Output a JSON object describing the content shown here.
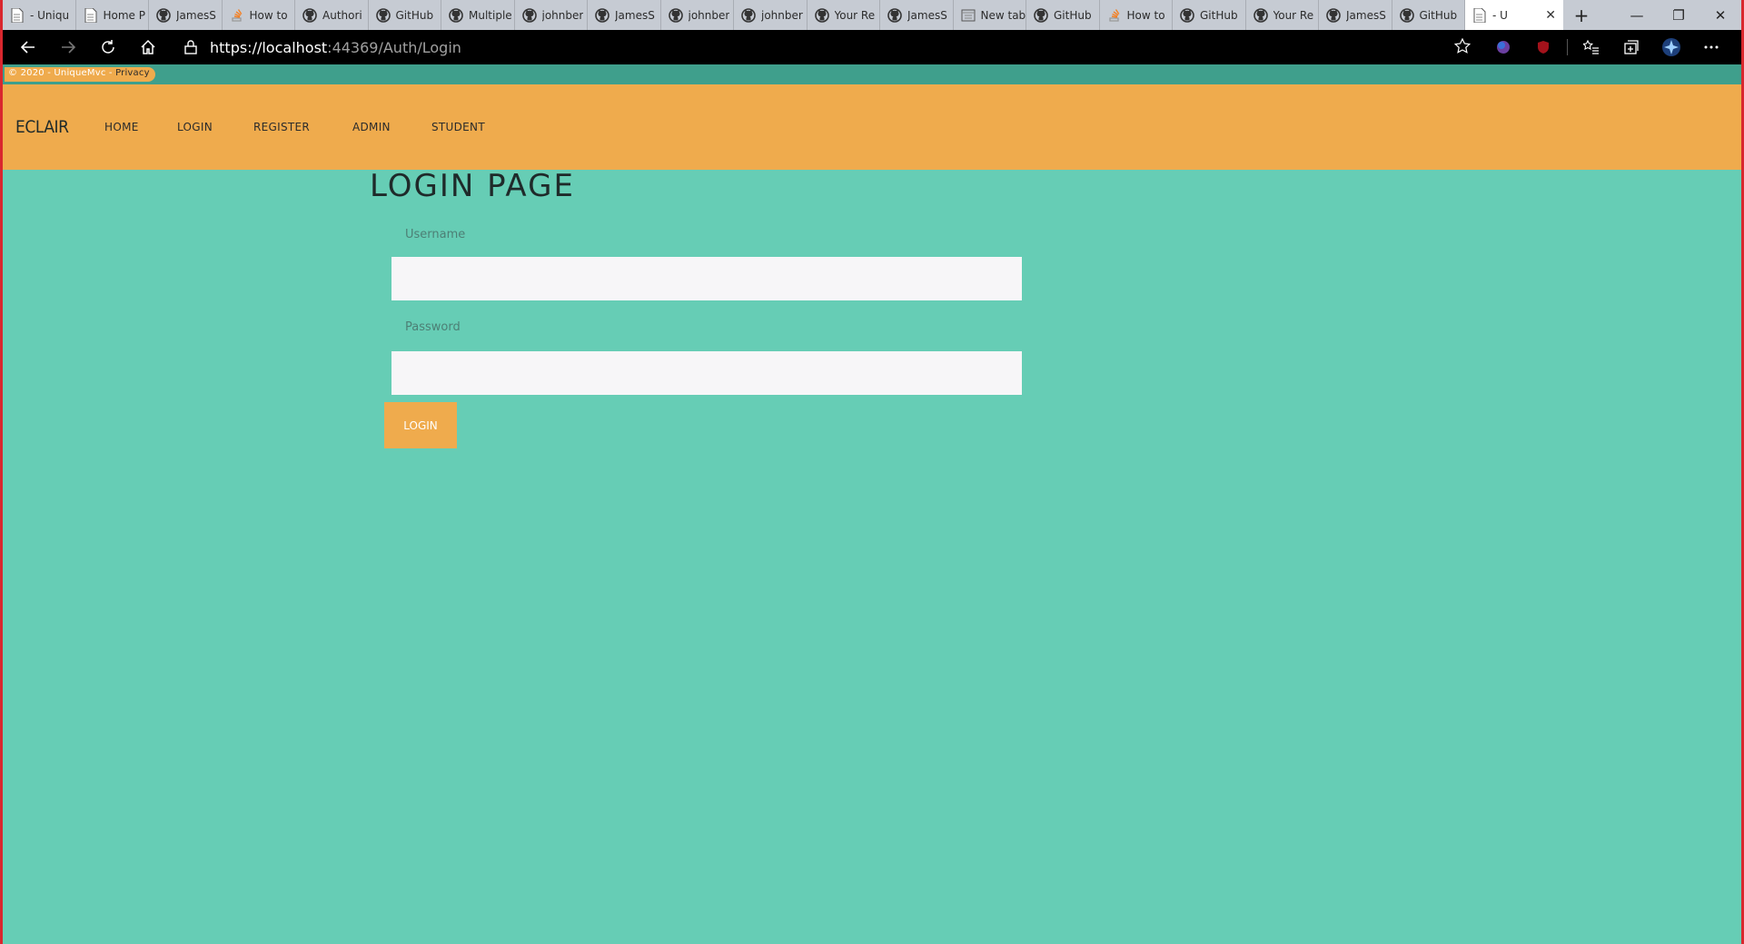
{
  "browser": {
    "tabs": [
      {
        "title": "- Uniqu",
        "icon": "page-icon"
      },
      {
        "title": "Home P",
        "icon": "page-icon"
      },
      {
        "title": "JamesS",
        "icon": "github-icon"
      },
      {
        "title": "How to",
        "icon": "stackoverflow-icon"
      },
      {
        "title": "Authori",
        "icon": "github-icon"
      },
      {
        "title": "GitHub",
        "icon": "github-icon"
      },
      {
        "title": "Multiple",
        "icon": "github-icon"
      },
      {
        "title": "johnber",
        "icon": "github-icon"
      },
      {
        "title": "JamesS",
        "icon": "github-icon"
      },
      {
        "title": "johnber",
        "icon": "github-icon"
      },
      {
        "title": "johnber",
        "icon": "github-icon"
      },
      {
        "title": "Your Re",
        "icon": "github-icon"
      },
      {
        "title": "JamesS",
        "icon": "github-icon"
      },
      {
        "title": "New tab",
        "icon": "newtab-icon"
      },
      {
        "title": "GitHub",
        "icon": "github-icon"
      },
      {
        "title": "How to",
        "icon": "stackoverflow-icon"
      },
      {
        "title": "GitHub",
        "icon": "github-icon"
      },
      {
        "title": "Your Re",
        "icon": "github-icon"
      },
      {
        "title": "JamesS",
        "icon": "github-icon"
      },
      {
        "title": "GitHub",
        "icon": "github-icon"
      }
    ],
    "active_tab": {
      "title": "- U",
      "icon": "page-icon"
    },
    "new_tab_label": "+",
    "window_controls": {
      "minimize": "—",
      "restore": "❐",
      "close": "✕"
    },
    "url_host": "https://localhost",
    "url_rest": ":44369/Auth/Login"
  },
  "site": {
    "copyright": "© 2020 - UniqueMvc - ",
    "privacy_link": "Privacy",
    "brand": "ECLAIR",
    "nav": {
      "home": "HOME",
      "login": "LOGIN",
      "register": "REGISTER",
      "admin": "ADMIN",
      "student": "STUDENT"
    }
  },
  "login_form": {
    "title": "LOGIN PAGE",
    "username_label": "Username",
    "username_value": "",
    "password_label": "Password",
    "password_value": "",
    "submit_label": "LOGIN"
  },
  "colors": {
    "page_bg": "#66cdb5",
    "navbar_bg": "#efab4d",
    "button_bg": "#efab4d",
    "input_bg": "#f7f6f8"
  }
}
